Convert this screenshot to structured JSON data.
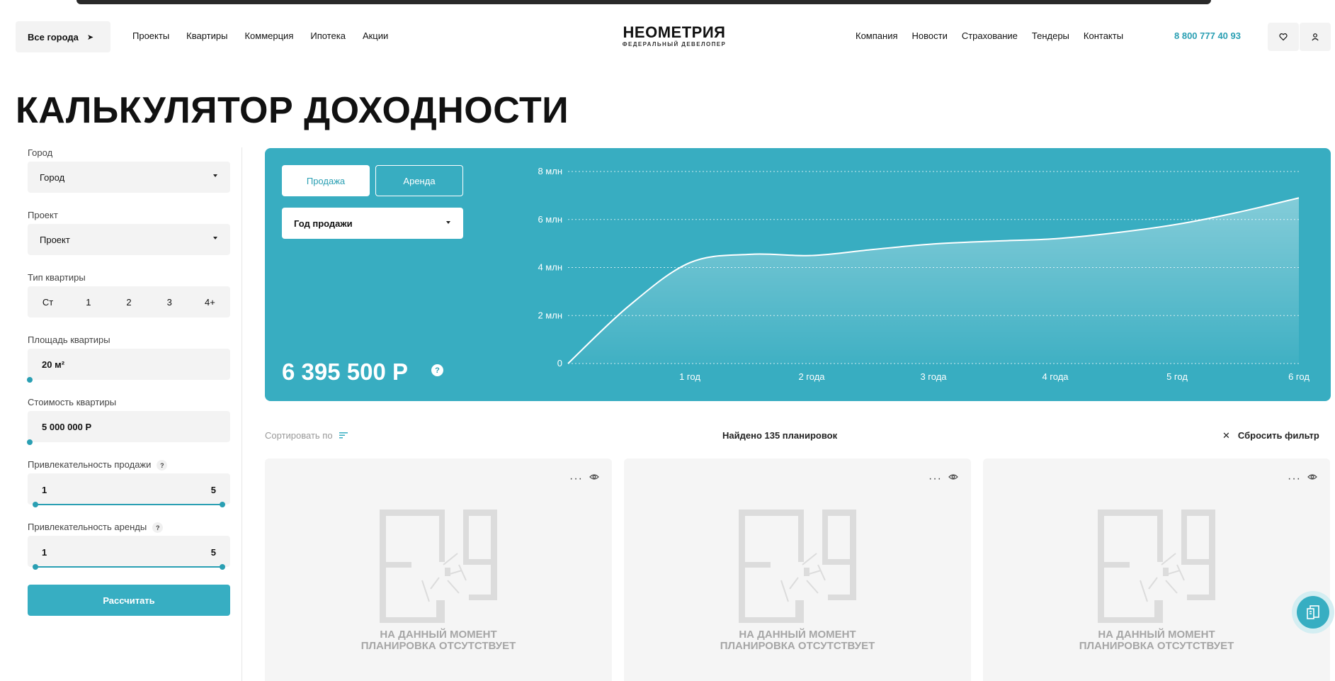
{
  "header": {
    "city_button": "Все города",
    "nav_left": [
      "Проекты",
      "Квартиры",
      "Коммерция",
      "Ипотека",
      "Акции"
    ],
    "logo_title": "НЕОМЕТРИЯ",
    "logo_subtitle": "ФЕДЕРАЛЬНЫЙ ДЕВЕЛОПЕР",
    "nav_right": [
      "Компания",
      "Новости",
      "Страхование",
      "Тендеры",
      "Контакты"
    ],
    "phone": "8 800 777 40 93",
    "icons": [
      "heart-icon",
      "user-icon"
    ]
  },
  "page_title": "КАЛЬКУЛЯТОР ДОХОДНОСТИ",
  "filters": {
    "city_label": "Город",
    "city_value": "Город",
    "project_label": "Проект",
    "project_value": "Проект",
    "type_label": "Тип квартиры",
    "types": [
      "Ст",
      "1",
      "2",
      "3",
      "4+"
    ],
    "area_label": "Площадь квартиры",
    "area_value": "20 м²",
    "price_label": "Стоимость квартиры",
    "price_value": "5 000 000 Р",
    "sale_attr_label": "Привлекательность продажи",
    "sale_attr_min": "1",
    "sale_attr_max": "5",
    "rent_attr_label": "Привлекательность аренды",
    "rent_attr_min": "1",
    "rent_attr_max": "5",
    "help": "?",
    "calculate": "Рассчитать"
  },
  "panel": {
    "mode_sale": "Продажа",
    "mode_rent": "Аренда",
    "year_select": "Год продажи",
    "total": "6 395 500 Р",
    "help": "?"
  },
  "chart_data": {
    "type": "area",
    "x": [
      0,
      0.5,
      1,
      1.5,
      2,
      2.5,
      3,
      3.5,
      4,
      4.5,
      5,
      5.5,
      6
    ],
    "x_tick_labels": [
      "1 год",
      "2 года",
      "3 года",
      "4 года",
      "5 год",
      "6 год"
    ],
    "y_tick_labels": [
      "0",
      "2 млн",
      "4 млн",
      "6 млн",
      "8 млн"
    ],
    "ylim": [
      0,
      8
    ],
    "series": [
      {
        "values": [
          0,
          2.4,
          4.2,
          4.55,
          4.5,
          4.75,
          4.98,
          5.1,
          5.2,
          5.45,
          5.8,
          6.3,
          6.9
        ]
      }
    ],
    "grid": true,
    "colors": {
      "background": "#38adc1",
      "line": "#ffffff"
    }
  },
  "results": {
    "sort_label": "Сортировать по",
    "found": "Найдено 135 планировок",
    "reset": "Сбросить фильтр",
    "reset_icon": "close-icon",
    "no_plan_line1": "НА ДАННЫЙ МОМЕНТ",
    "no_plan_line2": "ПЛАНИРОВКА ОТСУТСТВУЕТ",
    "card_count": 3
  },
  "colors": {
    "accent": "#37aec2",
    "panel": "#38adc1",
    "phone": "#2a9fb3"
  }
}
